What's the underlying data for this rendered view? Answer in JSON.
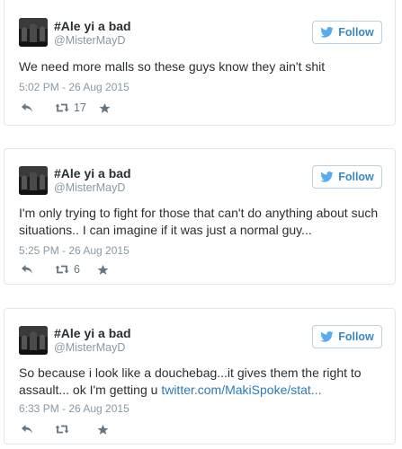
{
  "tweets": [
    {
      "display_name": "#Ale yi a bad",
      "handle": "@MisterMayD",
      "follow_label": "Follow",
      "text": "We need more malls so these guys know they ain't shit",
      "text_link": "",
      "timestamp": "5:02 PM - 26 Aug 2015",
      "retweet_count": "17"
    },
    {
      "display_name": "#Ale yi a bad",
      "handle": "@MisterMayD",
      "follow_label": "Follow",
      "text": "I'm only trying to fight for those that can't do anything about such situations.. I can imagine if it was just a normal guy...",
      "text_link": "",
      "timestamp": "5:25 PM - 26 Aug 2015",
      "retweet_count": "6"
    },
    {
      "display_name": "#Ale yi a bad",
      "handle": "@MisterMayD",
      "follow_label": "Follow",
      "text": "So because i look like a douchebag...it gives them the right to assault... ok I'm getting u ",
      "text_link": "twitter.com/MakiSpoke/stat...",
      "timestamp": "6:33 PM - 26 Aug 2015",
      "retweet_count": ""
    }
  ],
  "colors": {
    "follow_blue": "#3b88c3",
    "link_blue": "#2b7bb9",
    "meta_gray": "#8899a6",
    "text_dark": "#292f33"
  },
  "icons": {
    "follow": "twitter-bird-icon",
    "reply": "reply-icon",
    "retweet": "retweet-icon",
    "favorite": "star-icon"
  }
}
